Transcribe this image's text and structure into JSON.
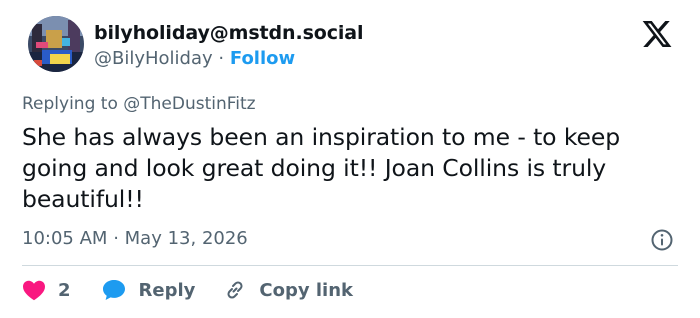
{
  "author": {
    "display_name": "bilyholiday@mstdn.social",
    "handle": "@BilyHoliday",
    "separator": "·",
    "follow_label": "Follow"
  },
  "replying_to": "Replying to @TheDustinFitz",
  "tweet": {
    "text": "She has always been an inspiration to me - to keep going and look great doing it!! Joan Collins is truly beautiful!!",
    "time": "10:05 AM",
    "date_separator": "·",
    "date": "May 13, 2026"
  },
  "actions": {
    "like_count": "2",
    "reply_label": "Reply",
    "copy_label": "Copy link"
  },
  "icons": {
    "platform": "x-logo-icon",
    "info": "info-icon",
    "like": "heart-icon",
    "reply": "speech-bubble-icon",
    "copy": "link-icon"
  },
  "colors": {
    "like": "#f91880",
    "reply": "#1d9bf0",
    "follow": "#1d9bf0",
    "secondary_text": "#536471",
    "primary_text": "#0f1419",
    "divider": "#cfd9de"
  }
}
